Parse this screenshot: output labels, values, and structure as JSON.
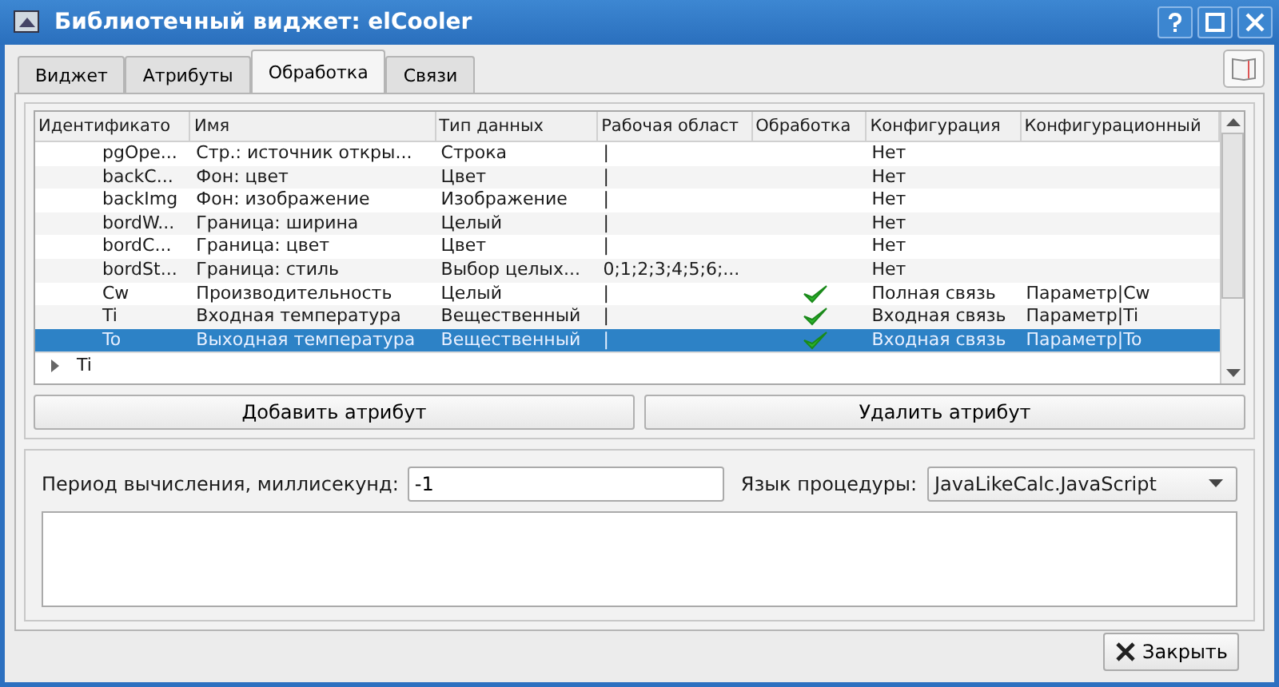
{
  "window": {
    "title": "Библиотечный виджет: elCooler"
  },
  "tabs": [
    {
      "label": "Виджет",
      "selected": false
    },
    {
      "label": "Атрибуты",
      "selected": false
    },
    {
      "label": "Обработка",
      "selected": true
    },
    {
      "label": "Связи",
      "selected": false
    }
  ],
  "table": {
    "columns": [
      "Идентификато",
      "Имя",
      "Тип данных",
      "Рабочая област",
      "Обработка",
      "Конфигурация",
      "Конфигурационный"
    ],
    "rows": [
      {
        "id": "pgOpe...",
        "name": "Стр.: источник откры...",
        "type": "Строка",
        "work": "|",
        "processing": false,
        "config": "Нет",
        "config_value": "",
        "selected": false
      },
      {
        "id": "backC...",
        "name": "Фон: цвет",
        "type": "Цвет",
        "work": "|",
        "processing": false,
        "config": "Нет",
        "config_value": "",
        "selected": false
      },
      {
        "id": "backImg",
        "name": "Фон: изображение",
        "type": "Изображение",
        "work": "|",
        "processing": false,
        "config": "Нет",
        "config_value": "",
        "selected": false
      },
      {
        "id": "bordW...",
        "name": "Граница: ширина",
        "type": "Целый",
        "work": "|",
        "processing": false,
        "config": "Нет",
        "config_value": "",
        "selected": false
      },
      {
        "id": "bordC...",
        "name": "Граница: цвет",
        "type": "Цвет",
        "work": "|",
        "processing": false,
        "config": "Нет",
        "config_value": "",
        "selected": false
      },
      {
        "id": "bordSt...",
        "name": "Граница: стиль",
        "type": "Выбор целых...",
        "work": "0;1;2;3;4;5;6;...",
        "processing": false,
        "config": "Нет",
        "config_value": "",
        "selected": false
      },
      {
        "id": "Cw",
        "name": "Производительность",
        "type": "Целый",
        "work": "|",
        "processing": true,
        "config": "Полная связь",
        "config_value": "Параметр|Cw",
        "selected": false
      },
      {
        "id": "Ti",
        "name": "Входная температура",
        "type": "Вещественный",
        "work": "|",
        "processing": true,
        "config": "Входная связь",
        "config_value": "Параметр|Ti",
        "selected": false
      },
      {
        "id": "To",
        "name": "Выходная температура",
        "type": "Вещественный",
        "work": "|",
        "processing": true,
        "config": "Входная связь",
        "config_value": "Параметр|To",
        "selected": true
      }
    ]
  },
  "tree_item": {
    "label": "Ti",
    "expanded": false
  },
  "buttons": {
    "add": "Добавить атрибут",
    "delete": "Удалить атрибут",
    "close": "Закрыть"
  },
  "period": {
    "label": "Период вычисления, миллисекунд:",
    "value": "-1"
  },
  "language": {
    "label": "Язык процедуры:",
    "value": "JavaLikeCalc.JavaScript"
  }
}
